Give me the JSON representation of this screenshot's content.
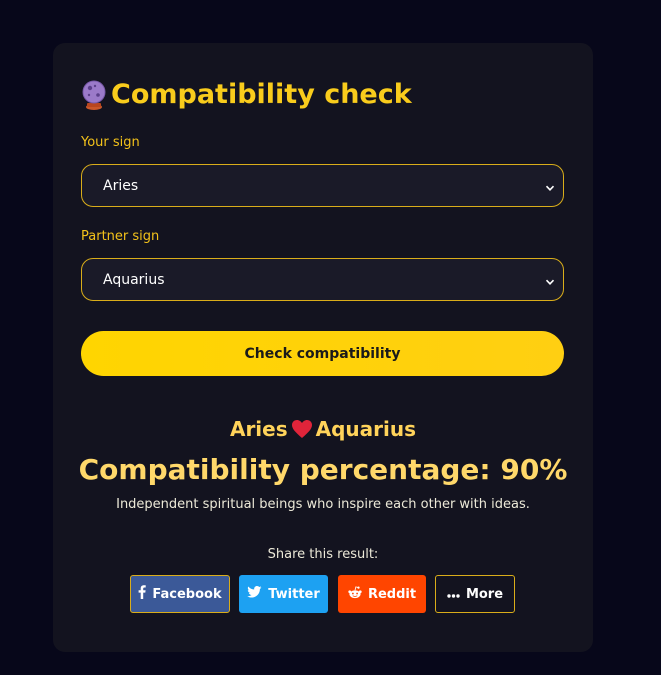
{
  "card": {
    "title": "Compatibility check",
    "title_icon": "crystal-ball-icon",
    "your_sign_label": "Your sign",
    "your_sign_value": "Aries",
    "partner_sign_label": "Partner sign",
    "partner_sign_value": "Aquarius",
    "check_button": "Check compatibility"
  },
  "result": {
    "sign_a": "Aries",
    "sign_b": "Aquarius",
    "heart_icon": "heart-icon",
    "percentage_text": "Compatibility percentage: 90%",
    "percentage": 90,
    "description": "Independent spiritual beings who inspire each other with ideas."
  },
  "share": {
    "label": "Share this result:",
    "buttons": [
      {
        "label": "Facebook",
        "icon": "facebook-icon"
      },
      {
        "label": "Twitter",
        "icon": "twitter-icon"
      },
      {
        "label": "Reddit",
        "icon": "reddit-icon"
      },
      {
        "label": "More",
        "icon": "more-dots-icon"
      }
    ]
  },
  "colors": {
    "background": "#07071a",
    "card": "#13131f",
    "accent": "#f9cc1c",
    "facebook": "#3b5998",
    "twitter": "#1da1f2",
    "reddit": "#ff4500"
  }
}
